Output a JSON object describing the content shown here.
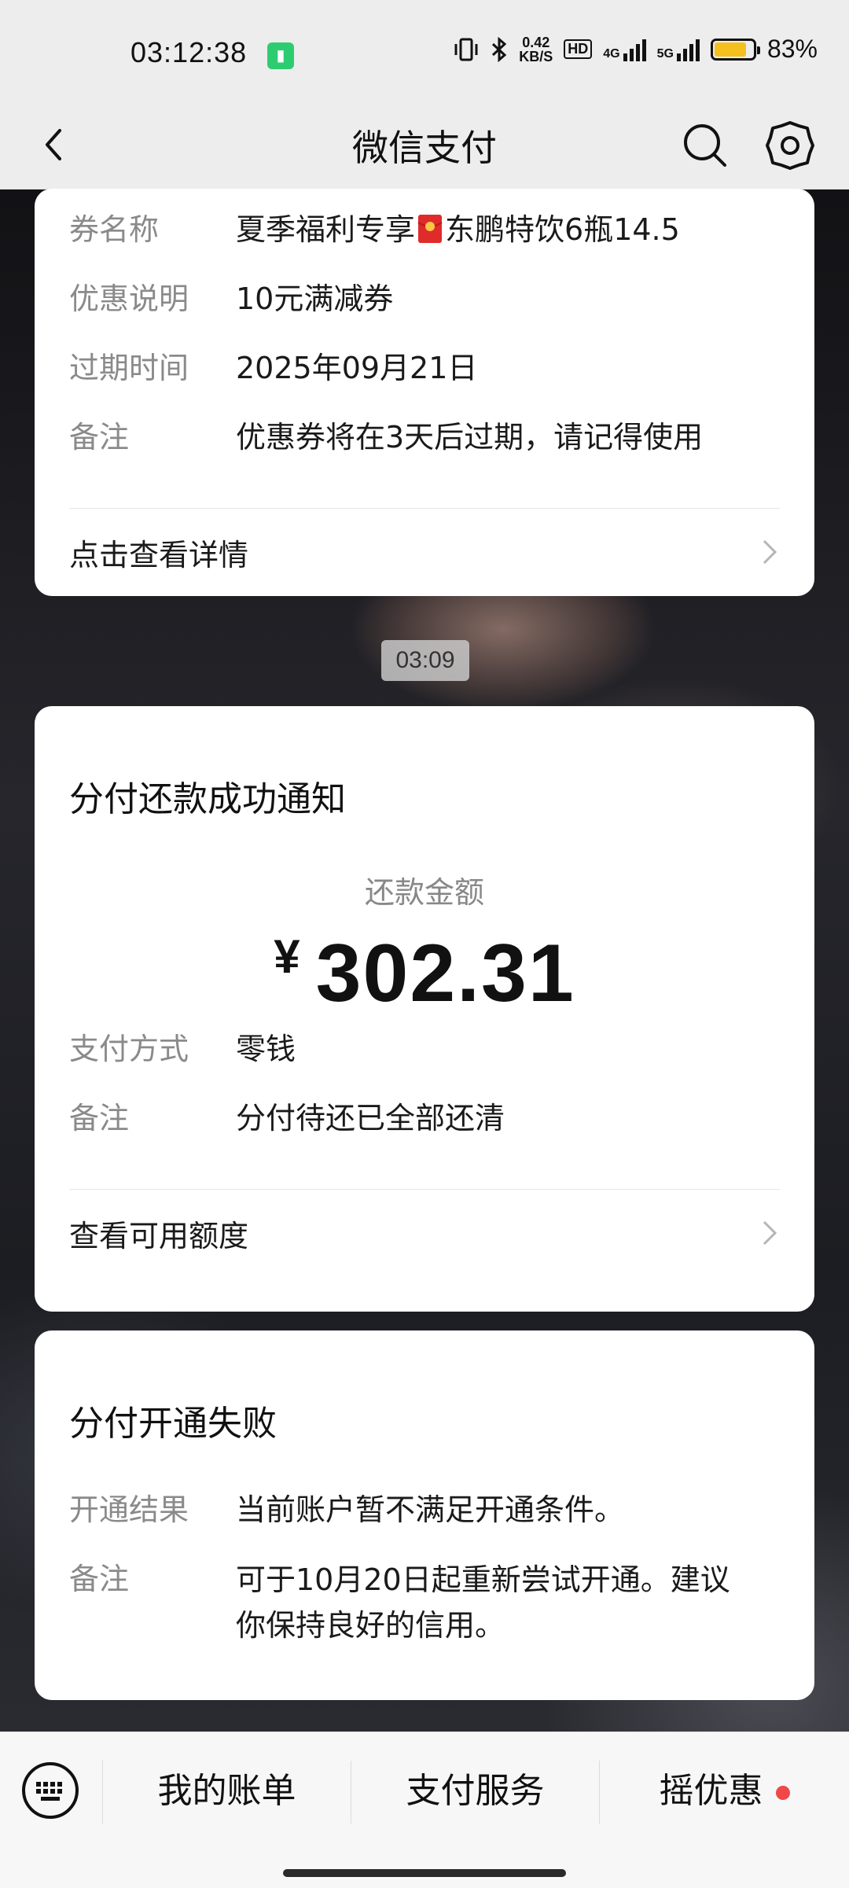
{
  "status_bar": {
    "time": "03:12:38",
    "net_speed_value": "0.42",
    "net_speed_unit": "KB/S",
    "hd_label": "HD",
    "net_4g": "4G",
    "net_5g": "5G",
    "battery_percent_text": "83%",
    "battery_level": 0.83,
    "battery_color": "#f4c01e"
  },
  "nav": {
    "title": "微信支付",
    "back_icon": "chevron-left-icon",
    "search_icon": "search-icon",
    "settings_icon": "gear-icon"
  },
  "coupon_card": {
    "rows": [
      {
        "label": "券名称",
        "value_pre": "夏季福利专享",
        "value_post": "东鹏特饮6瓶14.5",
        "emoji_icon": "red-envelope-icon"
      },
      {
        "label": "优惠说明",
        "value": "10元满减券"
      },
      {
        "label": "过期时间",
        "value": "2025年09月21日"
      },
      {
        "label": "备注",
        "value": "优惠券将在3天后过期，请记得使用"
      }
    ],
    "link_label": "点击查看详情"
  },
  "message_time": "03:09",
  "repayment_card": {
    "title": "分付还款成功通知",
    "amount_label": "还款金额",
    "currency": "¥",
    "amount": "302.31",
    "rows": [
      {
        "label": "支付方式",
        "value": "零钱"
      },
      {
        "label": "备注",
        "value": "分付待还已全部还清"
      }
    ],
    "link_label": "查看可用额度"
  },
  "failure_card": {
    "title": "分付开通失败",
    "rows": [
      {
        "label": "开通结果",
        "value": "当前账户暂不满足开通条件。"
      },
      {
        "label": "备注",
        "value_line1": "可于10月20日起重新尝试开通。建议",
        "value_line2": "你保持良好的信用。"
      }
    ]
  },
  "bottom_bar": {
    "keyboard_icon": "keyboard-icon",
    "tabs": [
      {
        "label": "我的账单"
      },
      {
        "label": "支付服务"
      },
      {
        "label": "摇优惠",
        "badge_color": "#f04848"
      }
    ]
  }
}
